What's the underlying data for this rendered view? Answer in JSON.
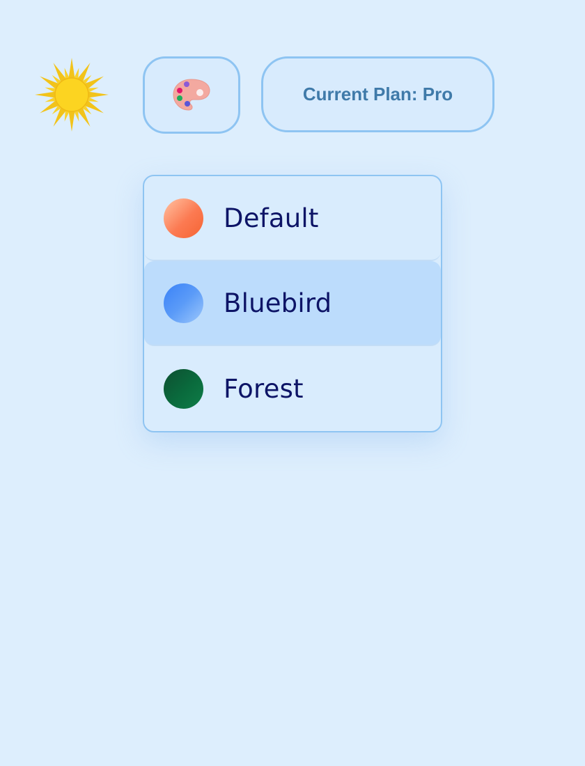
{
  "header": {
    "sun_icon": "sun-icon",
    "palette_icon": "palette-icon",
    "plan_label": "Current Plan: Pro"
  },
  "theme_menu": {
    "options": [
      {
        "label": "Default",
        "swatch_color": "#fc7a52",
        "selected": false
      },
      {
        "label": "Bluebird",
        "swatch_color": "#4a8df7",
        "selected": true
      },
      {
        "label": "Forest",
        "swatch_color": "#0a6b3d",
        "selected": false
      }
    ]
  },
  "colors": {
    "background": "#ddeefd",
    "border_accent": "#8ec4f2",
    "plan_text": "#3f7aa9",
    "option_text": "#0d1466",
    "selected_row": "#bcdcfc",
    "sun": "#fcd020"
  }
}
